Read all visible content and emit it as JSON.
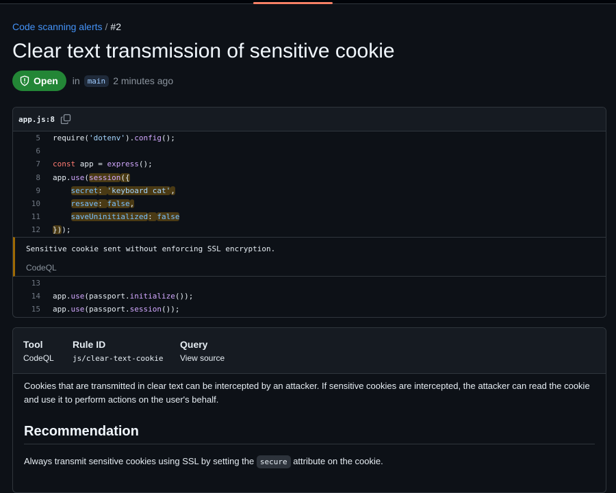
{
  "breadcrumb": {
    "link": "Code scanning alerts",
    "separator": "/",
    "current": "#2"
  },
  "title": "Clear text transmission of sensitive cookie",
  "status": {
    "badge": "Open",
    "in_label": "in",
    "branch": "main",
    "time": "2 minutes ago"
  },
  "code": {
    "file": "app.js:8",
    "lines_before": [
      {
        "n": "5",
        "tokens": [
          [
            "",
            "require("
          ],
          [
            "str",
            "'dotenv'"
          ],
          [
            "",
            ")."
          ],
          [
            "fn",
            "config"
          ],
          [
            "",
            "();"
          ]
        ]
      },
      {
        "n": "6",
        "tokens": []
      },
      {
        "n": "7",
        "tokens": [
          [
            "kw",
            "const"
          ],
          [
            "",
            " app = "
          ],
          [
            "fn",
            "express"
          ],
          [
            "",
            "();"
          ]
        ]
      },
      {
        "n": "8",
        "tokens": [
          [
            "",
            "app."
          ],
          [
            "fn",
            "use"
          ],
          [
            "",
            "("
          ],
          [
            "hl fn",
            "session"
          ],
          [
            "hl",
            "({"
          ]
        ]
      },
      {
        "n": "9",
        "tokens": [
          [
            "",
            "    "
          ],
          [
            "hl prop",
            "secret"
          ],
          [
            "hl",
            ": "
          ],
          [
            "hl str",
            "'keyboard cat'"
          ],
          [
            "hl",
            ","
          ]
        ]
      },
      {
        "n": "10",
        "tokens": [
          [
            "",
            "    "
          ],
          [
            "hl prop",
            "resave"
          ],
          [
            "hl",
            ": "
          ],
          [
            "hl lit",
            "false"
          ],
          [
            "hl",
            ","
          ]
        ]
      },
      {
        "n": "11",
        "tokens": [
          [
            "",
            "    "
          ],
          [
            "hl prop",
            "saveUninitialized"
          ],
          [
            "hl",
            ": "
          ],
          [
            "hl lit",
            "false"
          ]
        ]
      },
      {
        "n": "12",
        "tokens": [
          [
            "hl",
            "})"
          ],
          [
            "",
            ");"
          ]
        ]
      }
    ],
    "alert_message": "Sensitive cookie sent without enforcing SSL encryption.",
    "alert_tool": "CodeQL",
    "lines_after": [
      {
        "n": "13",
        "tokens": []
      },
      {
        "n": "14",
        "tokens": [
          [
            "",
            "app."
          ],
          [
            "fn",
            "use"
          ],
          [
            "",
            "(passport."
          ],
          [
            "fn",
            "initialize"
          ],
          [
            "",
            "());"
          ]
        ]
      },
      {
        "n": "15",
        "tokens": [
          [
            "",
            "app."
          ],
          [
            "fn",
            "use"
          ],
          [
            "",
            "(passport."
          ],
          [
            "fn",
            "session"
          ],
          [
            "",
            "());"
          ]
        ]
      }
    ]
  },
  "info": {
    "tool_header": "Tool",
    "tool_value": "CodeQL",
    "rule_header": "Rule ID",
    "rule_value": "js/clear-text-cookie",
    "query_header": "Query",
    "query_value": "View source",
    "description": "Cookies that are transmitted in clear text can be intercepted by an attacker. If sensitive cookies are intercepted, the attacker can read the cookie and use it to perform actions on the user's behalf.",
    "recommendation_title": "Recommendation",
    "recommendation_before": "Always transmit sensitive cookies using SSL by setting the ",
    "recommendation_code": "secure",
    "recommendation_after": " attribute on the cookie."
  },
  "colors": {
    "open_badge": "#238636",
    "link": "#4493f8",
    "highlight": "#4a3a14",
    "alert_border": "#9e6a03"
  }
}
